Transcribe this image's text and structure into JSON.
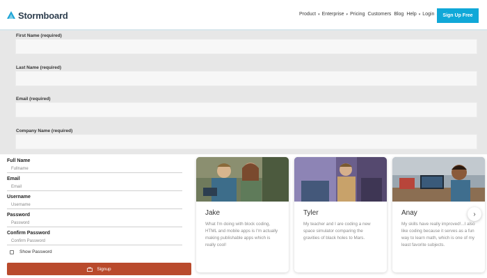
{
  "header": {
    "logo_text": "Stormboard",
    "nav": {
      "product": "Product",
      "enterprise": "Enterprise",
      "pricing": "Pricing",
      "customers": "Customers",
      "blog": "Blog",
      "help": "Help",
      "login": "Login →"
    },
    "signup_label": "Sign Up Free",
    "accent_color": "#10a8d8"
  },
  "top_form": {
    "fields": [
      {
        "label": "First Name (required)",
        "value": ""
      },
      {
        "label": "Last Name (required)",
        "value": ""
      },
      {
        "label": "Email (required)",
        "value": ""
      },
      {
        "label": "Company Name (required)",
        "value": ""
      }
    ]
  },
  "signup_form": {
    "fields": [
      {
        "label": "Full Name",
        "placeholder": "Fullname"
      },
      {
        "label": "Email",
        "placeholder": "Email"
      },
      {
        "label": "Username",
        "placeholder": "Username"
      },
      {
        "label": "Password",
        "placeholder": "Password"
      },
      {
        "label": "Confirm Password",
        "placeholder": "Confirm Password"
      }
    ],
    "show_password_label": "Show Password",
    "signup_label": "Signup",
    "button_color": "#b94a2c"
  },
  "testimonials": [
    {
      "name": "Jake",
      "quote": "What I'm doing with block coding, HTML and mobile apps is I'm actually making publishable apps which is really cool!"
    },
    {
      "name": "Tyler",
      "quote": "My teacher and I are coding a new space simulator comparing the gravities of black holes to Mars."
    },
    {
      "name": "Anay",
      "quote": "My skills have really improved!...I also like coding because it serves as a fun way to learn math, which is one of my least favorite subjects."
    }
  ],
  "carousel": {
    "next_icon": "chevron-right-icon",
    "next_glyph": "›"
  }
}
